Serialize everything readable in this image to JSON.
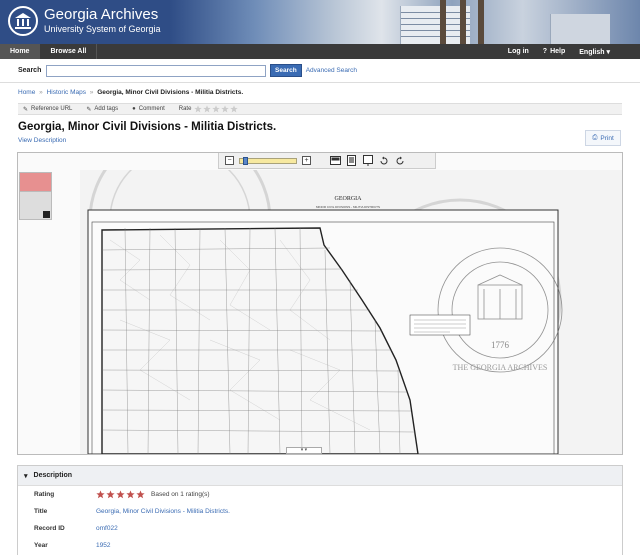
{
  "header": {
    "title": "Georgia Archives",
    "subtitle": "University System of Georgia"
  },
  "nav": {
    "home": "Home",
    "browse": "Browse All",
    "login": "Log in",
    "help": "Help",
    "language": "English"
  },
  "search": {
    "label": "Search",
    "value": "",
    "button": "Search",
    "advanced": "Advanced Search"
  },
  "breadcrumb": {
    "items": [
      "Home",
      "Historic Maps",
      "Georgia, Minor Civil Divisions - Militia Districts."
    ],
    "separator": "»"
  },
  "tools": {
    "reference": "Reference URL",
    "tags": "Add tags",
    "comment": "Comment",
    "rate": "Rate"
  },
  "item": {
    "title": "Georgia, Minor Civil Divisions - Militia Districts.",
    "view_description": "View Description",
    "print": "Print"
  },
  "viewer": {
    "zoom_level": 0.05
  },
  "map": {
    "heading": "GEORGIA",
    "subheading": "MINOR CIVIL DIVISIONS - MILITIA DISTRICTS",
    "seal_year": "1776",
    "seal_arc_text": "THE GEORGIA ARCHIVES"
  },
  "description": {
    "heading": "Description",
    "rows": [
      {
        "key": "Rating",
        "value": "Based on 1 rating(s)",
        "stars": 5
      },
      {
        "key": "Title",
        "value": "Georgia, Minor Civil Divisions - Militia Districts."
      },
      {
        "key": "Record ID",
        "value": "omf022"
      },
      {
        "key": "Year",
        "value": "1952"
      }
    ]
  },
  "colors": {
    "header_blue": "#2f4d86",
    "link_blue": "#3a6bb3",
    "navbar": "#3a3a3a",
    "star_red": "#c0504d"
  }
}
